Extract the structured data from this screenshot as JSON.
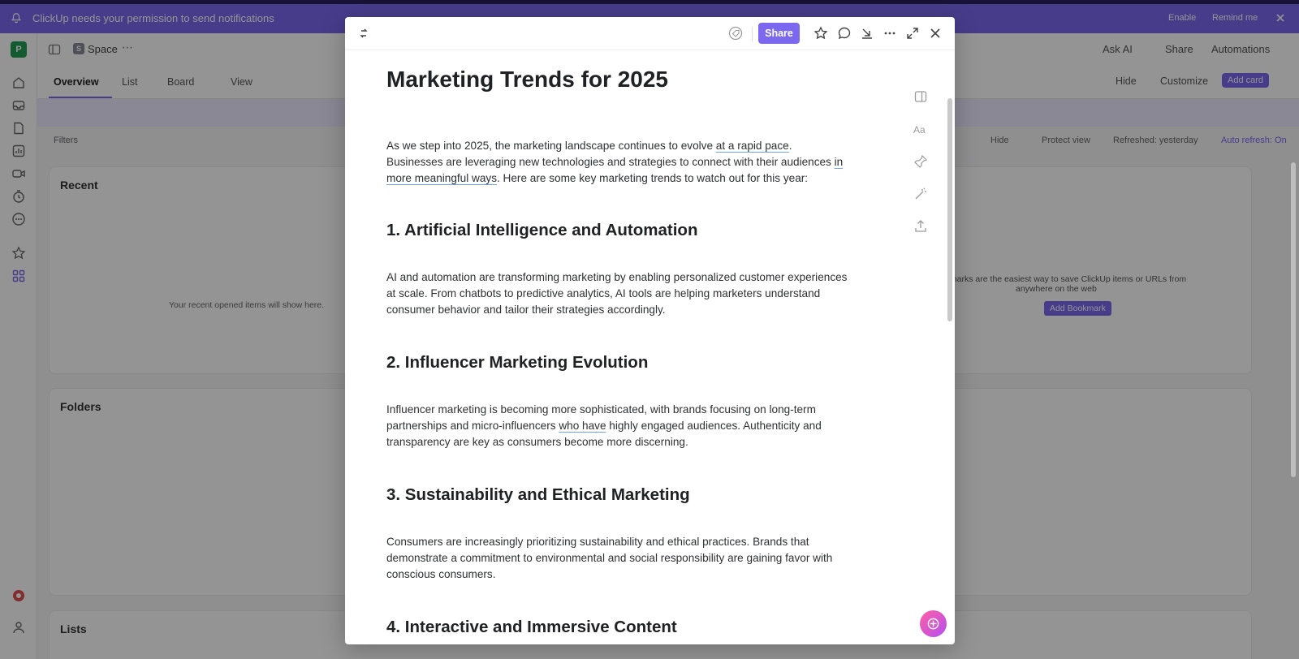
{
  "notification": {
    "message": "ClickUp needs your permission to send notifications",
    "enable": "Enable",
    "remind": "Remind me"
  },
  "workspace": {
    "avatar_letter": "P"
  },
  "header": {
    "space_badge": "S",
    "space_name": "Space",
    "ask_ai": "Ask AI",
    "share": "Share",
    "automations": "Automations"
  },
  "tabs": [
    "Overview",
    "List",
    "Board",
    "View"
  ],
  "toolbar_right": {
    "hide": "Hide",
    "customize": "Customize",
    "add_card": "Add card"
  },
  "filters_bar": {
    "filters": "Filters",
    "hide": "Hide",
    "protect_view": "Protect view",
    "refreshed": "Refreshed: yesterday",
    "auto_refresh": "Auto refresh: On"
  },
  "cards": {
    "recent_title": "Recent",
    "recent_empty": "Your recent opened items will show here.",
    "folders_title": "Folders",
    "lists_title": "Lists",
    "bookmarks_text_1": "ookmarks are the easiest way to save ClickUp items or URLs from",
    "bookmarks_text_2": "anywhere on the web",
    "add_bookmark": "Add Bookmark"
  },
  "modal": {
    "share": "Share",
    "title": "Marketing Trends for 2025",
    "intro": {
      "part1": "As we step into 2025, the marketing landscape continues to evolve ",
      "u1": "at a rapid pace",
      "part2": ". Businesses are leveraging new technologies and strategies to connect with their audiences ",
      "u2": "in more meaningful ways",
      "part3": ". Here are some key marketing trends to watch out for this year:"
    },
    "sections": [
      {
        "heading": "1. Artificial Intelligence and Automation",
        "body": "AI and automation are transforming marketing by enabling personalized customer experiences at scale. From chatbots to predictive analytics, AI tools are helping marketers understand consumer behavior and tailor their strategies accordingly."
      },
      {
        "heading": "2. Influencer Marketing Evolution",
        "body_a": "Influencer marketing is becoming more sophisticated, with brands focusing on long-term partnerships and micro-influencers ",
        "body_u": "who have",
        "body_b": " highly engaged audiences. Authenticity and transparency are key as consumers become more discerning."
      },
      {
        "heading": "3. Sustainability and Ethical Marketing",
        "body": "Consumers are increasingly prioritizing sustainability and ethical practices. Brands that demonstrate a commitment to environmental and social responsibility are gaining favor with conscious consumers."
      },
      {
        "heading": "4. Interactive and Immersive Content"
      }
    ]
  },
  "colors": {
    "accent": "#7b68ee",
    "notif_bg": "#7b68ee",
    "fab": "#d94ec4"
  }
}
